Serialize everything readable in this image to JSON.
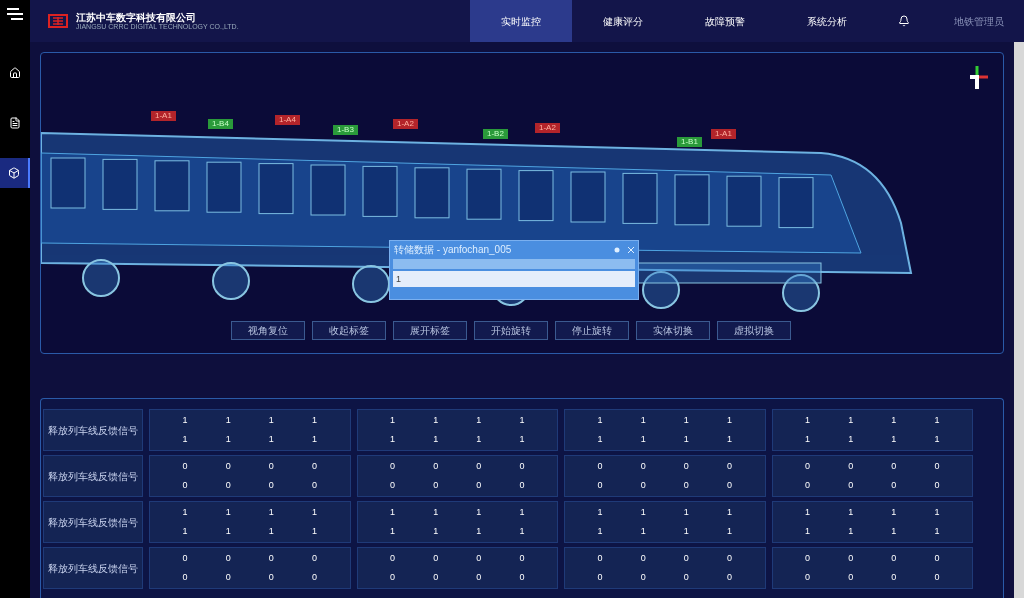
{
  "header": {
    "company": "江苏中车数字科技有限公司",
    "company_en": "JIANGSU CRRC DIGITAL TECHNOLOGY CO.,LTD.",
    "user": "地铁管理员"
  },
  "nav": [
    {
      "label": "实时监控",
      "selected": true
    },
    {
      "label": "健康评分",
      "selected": false
    },
    {
      "label": "故障预警",
      "selected": false
    },
    {
      "label": "系统分析",
      "selected": false
    }
  ],
  "sidebar": [
    {
      "kind": "home",
      "selected": false
    },
    {
      "kind": "file",
      "selected": false
    },
    {
      "kind": "cube",
      "selected": true
    }
  ],
  "train_tags": [
    {
      "label": "1-A1",
      "kind": "a"
    },
    {
      "label": "1-B4",
      "kind": "b"
    },
    {
      "label": "1-A4",
      "kind": "a"
    },
    {
      "label": "1-B3",
      "kind": "b"
    },
    {
      "label": "1-A2",
      "kind": "a"
    },
    {
      "label": "1-B2",
      "kind": "b"
    },
    {
      "label": "1-A2",
      "kind": "a"
    },
    {
      "label": "1-B1",
      "kind": "b"
    },
    {
      "label": "1-A1",
      "kind": "a"
    }
  ],
  "dialog": {
    "title": "转储数据 - yanfochan_005",
    "value": "1"
  },
  "viewer_buttons": [
    "视角复位",
    "收起标签",
    "展开标签",
    "开始旋转",
    "停止旋转",
    "实体切换",
    "虚拟切换"
  ],
  "table": {
    "rows": [
      {
        "label": "释放列车线反馈信号",
        "groups": [
          [
            [
              "1",
              "1",
              "1",
              "1"
            ],
            [
              "1",
              "1",
              "1",
              "1"
            ]
          ],
          [
            [
              "1",
              "1",
              "1",
              "1"
            ],
            [
              "1",
              "1",
              "1",
              "1"
            ]
          ],
          [
            [
              "1",
              "1",
              "1",
              "1"
            ],
            [
              "1",
              "1",
              "1",
              "1"
            ]
          ],
          [
            [
              "1",
              "1",
              "1",
              "1"
            ],
            [
              "1",
              "1",
              "1",
              "1"
            ]
          ]
        ]
      },
      {
        "label": "释放列车线反馈信号",
        "groups": [
          [
            [
              "0",
              "0",
              "0",
              "0"
            ],
            [
              "0",
              "0",
              "0",
              "0"
            ]
          ],
          [
            [
              "0",
              "0",
              "0",
              "0"
            ],
            [
              "0",
              "0",
              "0",
              "0"
            ]
          ],
          [
            [
              "0",
              "0",
              "0",
              "0"
            ],
            [
              "0",
              "0",
              "0",
              "0"
            ]
          ],
          [
            [
              "0",
              "0",
              "0",
              "0"
            ],
            [
              "0",
              "0",
              "0",
              "0"
            ]
          ]
        ]
      },
      {
        "label": "释放列车线反馈信号",
        "groups": [
          [
            [
              "1",
              "1",
              "1",
              "1"
            ],
            [
              "1",
              "1",
              "1",
              "1"
            ]
          ],
          [
            [
              "1",
              "1",
              "1",
              "1"
            ],
            [
              "1",
              "1",
              "1",
              "1"
            ]
          ],
          [
            [
              "1",
              "1",
              "1",
              "1"
            ],
            [
              "1",
              "1",
              "1",
              "1"
            ]
          ],
          [
            [
              "1",
              "1",
              "1",
              "1"
            ],
            [
              "1",
              "1",
              "1",
              "1"
            ]
          ]
        ]
      },
      {
        "label": "释放列车线反馈信号",
        "groups": [
          [
            [
              "0",
              "0",
              "0",
              "0"
            ],
            [
              "0",
              "0",
              "0",
              "0"
            ]
          ],
          [
            [
              "0",
              "0",
              "0",
              "0"
            ],
            [
              "0",
              "0",
              "0",
              "0"
            ]
          ],
          [
            [
              "0",
              "0",
              "0",
              "0"
            ],
            [
              "0",
              "0",
              "0",
              "0"
            ]
          ],
          [
            [
              "0",
              "0",
              "0",
              "0"
            ],
            [
              "0",
              "0",
              "0",
              "0"
            ]
          ]
        ]
      }
    ]
  }
}
